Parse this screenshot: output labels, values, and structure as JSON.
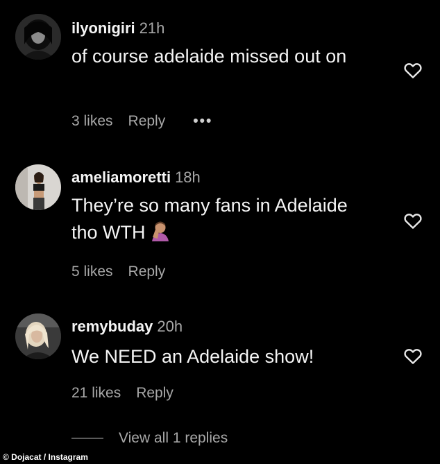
{
  "comments": [
    {
      "username": "ilyonigiri",
      "time": "21h",
      "text": "of course adelaide missed out on",
      "likes": "3 likes",
      "reply": "Reply",
      "more": "•••",
      "avatar_icon": "dark-haired-person-avatar",
      "like_icon": "heart-outline-icon"
    },
    {
      "username": "ameliamoretti",
      "time": "18h",
      "text": "They’re so many fans in Adelaide tho WTH",
      "emoji_icon": "person-facepalming-emoji",
      "likes": "5 likes",
      "reply": "Reply",
      "avatar_icon": "mirror-selfie-avatar",
      "like_icon": "heart-outline-icon"
    },
    {
      "username": "remybuday",
      "time": "20h",
      "text": "We NEED an Adelaide show!",
      "likes": "21 likes",
      "reply": "Reply",
      "avatar_icon": "blonde-person-avatar",
      "like_icon": "heart-outline-icon"
    }
  ],
  "view_replies": "View all 1 replies",
  "credit": "© Dojacat / Instagram",
  "colors": {
    "background": "#000000",
    "primary_text": "#f5f5f5",
    "secondary_text": "#a8a8a8"
  }
}
